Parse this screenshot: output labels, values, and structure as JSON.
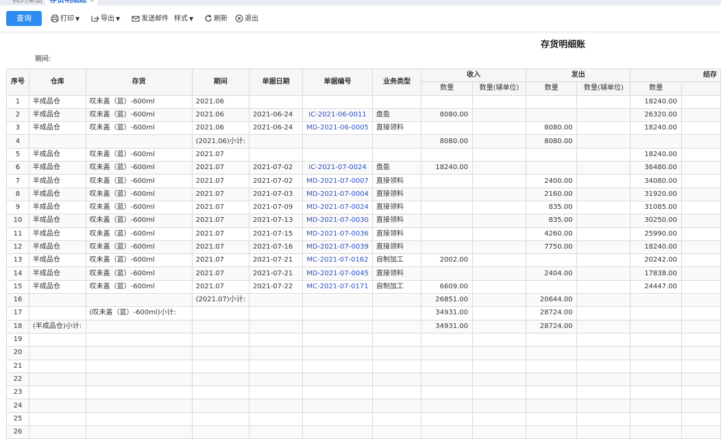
{
  "tabs": [
    {
      "label": "我的桌面"
    },
    {
      "label": "存货明细账"
    }
  ],
  "toolbar": {
    "query": "查询",
    "print": "打印",
    "export": "导出",
    "email": "发送邮件",
    "style": "样式",
    "refresh": "刷新",
    "exit": "退出"
  },
  "report": {
    "title": "存货明细账",
    "period_label": "期间:"
  },
  "headers": {
    "no": "序号",
    "warehouse": "仓库",
    "inventory": "存货",
    "period": "期间",
    "doc_date": "单据日期",
    "doc_no": "单据编号",
    "biz_type": "业务类型",
    "income": "收入",
    "issue": "发出",
    "balance": "结存",
    "qty": "数量",
    "qty_aux": "数量(辅单位)"
  },
  "rows": [
    {
      "no": "1",
      "wh": "半成品仓",
      "inv": "叹未盖（蓝）-600ml",
      "period": "2021.06",
      "date": "",
      "docno": "",
      "type": "",
      "in_qty": "",
      "in_aux": "",
      "out_qty": "",
      "out_aux": "",
      "bal": "18240.00"
    },
    {
      "no": "2",
      "wh": "半成品仓",
      "inv": "叹未盖（蓝）-600ml",
      "period": "2021.06",
      "date": "2021-06-24",
      "docno": "IC-2021-06-0011",
      "type": "盘盈",
      "in_qty": "8080.00",
      "in_aux": "",
      "out_qty": "",
      "out_aux": "",
      "bal": "26320.00"
    },
    {
      "no": "3",
      "wh": "半成品仓",
      "inv": "叹未盖（蓝）-600ml",
      "period": "2021.06",
      "date": "2021-06-24",
      "docno": "MD-2021-06-0005",
      "type": "直接领料",
      "in_qty": "",
      "in_aux": "",
      "out_qty": "8080.00",
      "out_aux": "",
      "bal": "18240.00"
    },
    {
      "no": "4",
      "wh": "",
      "inv": "",
      "period": "(2021.06)小计:",
      "date": "",
      "docno": "",
      "type": "",
      "in_qty": "8080.00",
      "in_aux": "",
      "out_qty": "8080.00",
      "out_aux": "",
      "bal": ""
    },
    {
      "no": "5",
      "wh": "半成品仓",
      "inv": "叹未盖（蓝）-600ml",
      "period": "2021.07",
      "date": "",
      "docno": "",
      "type": "",
      "in_qty": "",
      "in_aux": "",
      "out_qty": "",
      "out_aux": "",
      "bal": "18240.00"
    },
    {
      "no": "6",
      "wh": "半成品仓",
      "inv": "叹未盖（蓝）-600ml",
      "period": "2021.07",
      "date": "2021-07-02",
      "docno": "IC-2021-07-0024",
      "type": "盘盈",
      "in_qty": "18240.00",
      "in_aux": "",
      "out_qty": "",
      "out_aux": "",
      "bal": "36480.00"
    },
    {
      "no": "7",
      "wh": "半成品仓",
      "inv": "叹未盖（蓝）-600ml",
      "period": "2021.07",
      "date": "2021-07-02",
      "docno": "MD-2021-07-0007",
      "type": "直接领料",
      "in_qty": "",
      "in_aux": "",
      "out_qty": "2400.00",
      "out_aux": "",
      "bal": "34080.00"
    },
    {
      "no": "8",
      "wh": "半成品仓",
      "inv": "叹未盖（蓝）-600ml",
      "period": "2021.07",
      "date": "2021-07-03",
      "docno": "MD-2021-07-0004",
      "type": "直接领料",
      "in_qty": "",
      "in_aux": "",
      "out_qty": "2160.00",
      "out_aux": "",
      "bal": "31920.00"
    },
    {
      "no": "9",
      "wh": "半成品仓",
      "inv": "叹未盖（蓝）-600ml",
      "period": "2021.07",
      "date": "2021-07-09",
      "docno": "MD-2021-07-0024",
      "type": "直接领料",
      "in_qty": "",
      "in_aux": "",
      "out_qty": "835.00",
      "out_aux": "",
      "bal": "31085.00"
    },
    {
      "no": "10",
      "wh": "半成品仓",
      "inv": "叹未盖（蓝）-600ml",
      "period": "2021.07",
      "date": "2021-07-13",
      "docno": "MD-2021-07-0030",
      "type": "直接领料",
      "in_qty": "",
      "in_aux": "",
      "out_qty": "835.00",
      "out_aux": "",
      "bal": "30250.00"
    },
    {
      "no": "11",
      "wh": "半成品仓",
      "inv": "叹未盖（蓝）-600ml",
      "period": "2021.07",
      "date": "2021-07-15",
      "docno": "MD-2021-07-0036",
      "type": "直接领料",
      "in_qty": "",
      "in_aux": "",
      "out_qty": "4260.00",
      "out_aux": "",
      "bal": "25990.00"
    },
    {
      "no": "12",
      "wh": "半成品仓",
      "inv": "叹未盖（蓝）-600ml",
      "period": "2021.07",
      "date": "2021-07-16",
      "docno": "MD-2021-07-0039",
      "type": "直接领料",
      "in_qty": "",
      "in_aux": "",
      "out_qty": "7750.00",
      "out_aux": "",
      "bal": "18240.00"
    },
    {
      "no": "13",
      "wh": "半成品仓",
      "inv": "叹未盖（蓝）-600ml",
      "period": "2021.07",
      "date": "2021-07-21",
      "docno": "MC-2021-07-0162",
      "type": "自制加工",
      "in_qty": "2002.00",
      "in_aux": "",
      "out_qty": "",
      "out_aux": "",
      "bal": "20242.00"
    },
    {
      "no": "14",
      "wh": "半成品仓",
      "inv": "叹未盖（蓝）-600ml",
      "period": "2021.07",
      "date": "2021-07-21",
      "docno": "MD-2021-07-0045",
      "type": "直接领料",
      "in_qty": "",
      "in_aux": "",
      "out_qty": "2404.00",
      "out_aux": "",
      "bal": "17838.00"
    },
    {
      "no": "15",
      "wh": "半成品仓",
      "inv": "叹未盖（蓝）-600ml",
      "period": "2021.07",
      "date": "2021-07-22",
      "docno": "MC-2021-07-0171",
      "type": "自制加工",
      "in_qty": "6609.00",
      "in_aux": "",
      "out_qty": "",
      "out_aux": "",
      "bal": "24447.00"
    },
    {
      "no": "16",
      "wh": "",
      "inv": "",
      "period": "(2021.07)小计:",
      "date": "",
      "docno": "",
      "type": "",
      "in_qty": "26851.00",
      "in_aux": "",
      "out_qty": "20644.00",
      "out_aux": "",
      "bal": ""
    },
    {
      "no": "17",
      "wh": "",
      "inv": "(叹未盖（蓝）-600ml)小计:",
      "period": "",
      "date": "",
      "docno": "",
      "type": "",
      "in_qty": "34931.00",
      "in_aux": "",
      "out_qty": "28724.00",
      "out_aux": "",
      "bal": ""
    },
    {
      "no": "18",
      "wh": "(半成品仓)小计:",
      "inv": "",
      "period": "",
      "date": "",
      "docno": "",
      "type": "",
      "in_qty": "34931.00",
      "in_aux": "",
      "out_qty": "28724.00",
      "out_aux": "",
      "bal": ""
    },
    {
      "no": "19",
      "wh": "",
      "inv": "",
      "period": "",
      "date": "",
      "docno": "",
      "type": "",
      "in_qty": "",
      "in_aux": "",
      "out_qty": "",
      "out_aux": "",
      "bal": ""
    },
    {
      "no": "20",
      "wh": "",
      "inv": "",
      "period": "",
      "date": "",
      "docno": "",
      "type": "",
      "in_qty": "",
      "in_aux": "",
      "out_qty": "",
      "out_aux": "",
      "bal": ""
    },
    {
      "no": "21",
      "wh": "",
      "inv": "",
      "period": "",
      "date": "",
      "docno": "",
      "type": "",
      "in_qty": "",
      "in_aux": "",
      "out_qty": "",
      "out_aux": "",
      "bal": ""
    },
    {
      "no": "22",
      "wh": "",
      "inv": "",
      "period": "",
      "date": "",
      "docno": "",
      "type": "",
      "in_qty": "",
      "in_aux": "",
      "out_qty": "",
      "out_aux": "",
      "bal": ""
    },
    {
      "no": "23",
      "wh": "",
      "inv": "",
      "period": "",
      "date": "",
      "docno": "",
      "type": "",
      "in_qty": "",
      "in_aux": "",
      "out_qty": "",
      "out_aux": "",
      "bal": ""
    },
    {
      "no": "24",
      "wh": "",
      "inv": "",
      "period": "",
      "date": "",
      "docno": "",
      "type": "",
      "in_qty": "",
      "in_aux": "",
      "out_qty": "",
      "out_aux": "",
      "bal": ""
    },
    {
      "no": "25",
      "wh": "",
      "inv": "",
      "period": "",
      "date": "",
      "docno": "",
      "type": "",
      "in_qty": "",
      "in_aux": "",
      "out_qty": "",
      "out_aux": "",
      "bal": ""
    },
    {
      "no": "26",
      "wh": "",
      "inv": "",
      "period": "",
      "date": "",
      "docno": "",
      "type": "",
      "in_qty": "",
      "in_aux": "",
      "out_qty": "",
      "out_aux": "",
      "bal": ""
    }
  ],
  "icons": {
    "print": "printer-icon",
    "export": "export-icon",
    "email": "envelope-icon",
    "refresh": "refresh-icon",
    "exit": "close-circle-icon"
  },
  "colors": {
    "primary": "#2d8cf0",
    "link": "#2a4fc9",
    "header_bg": "#f5f6f7"
  }
}
